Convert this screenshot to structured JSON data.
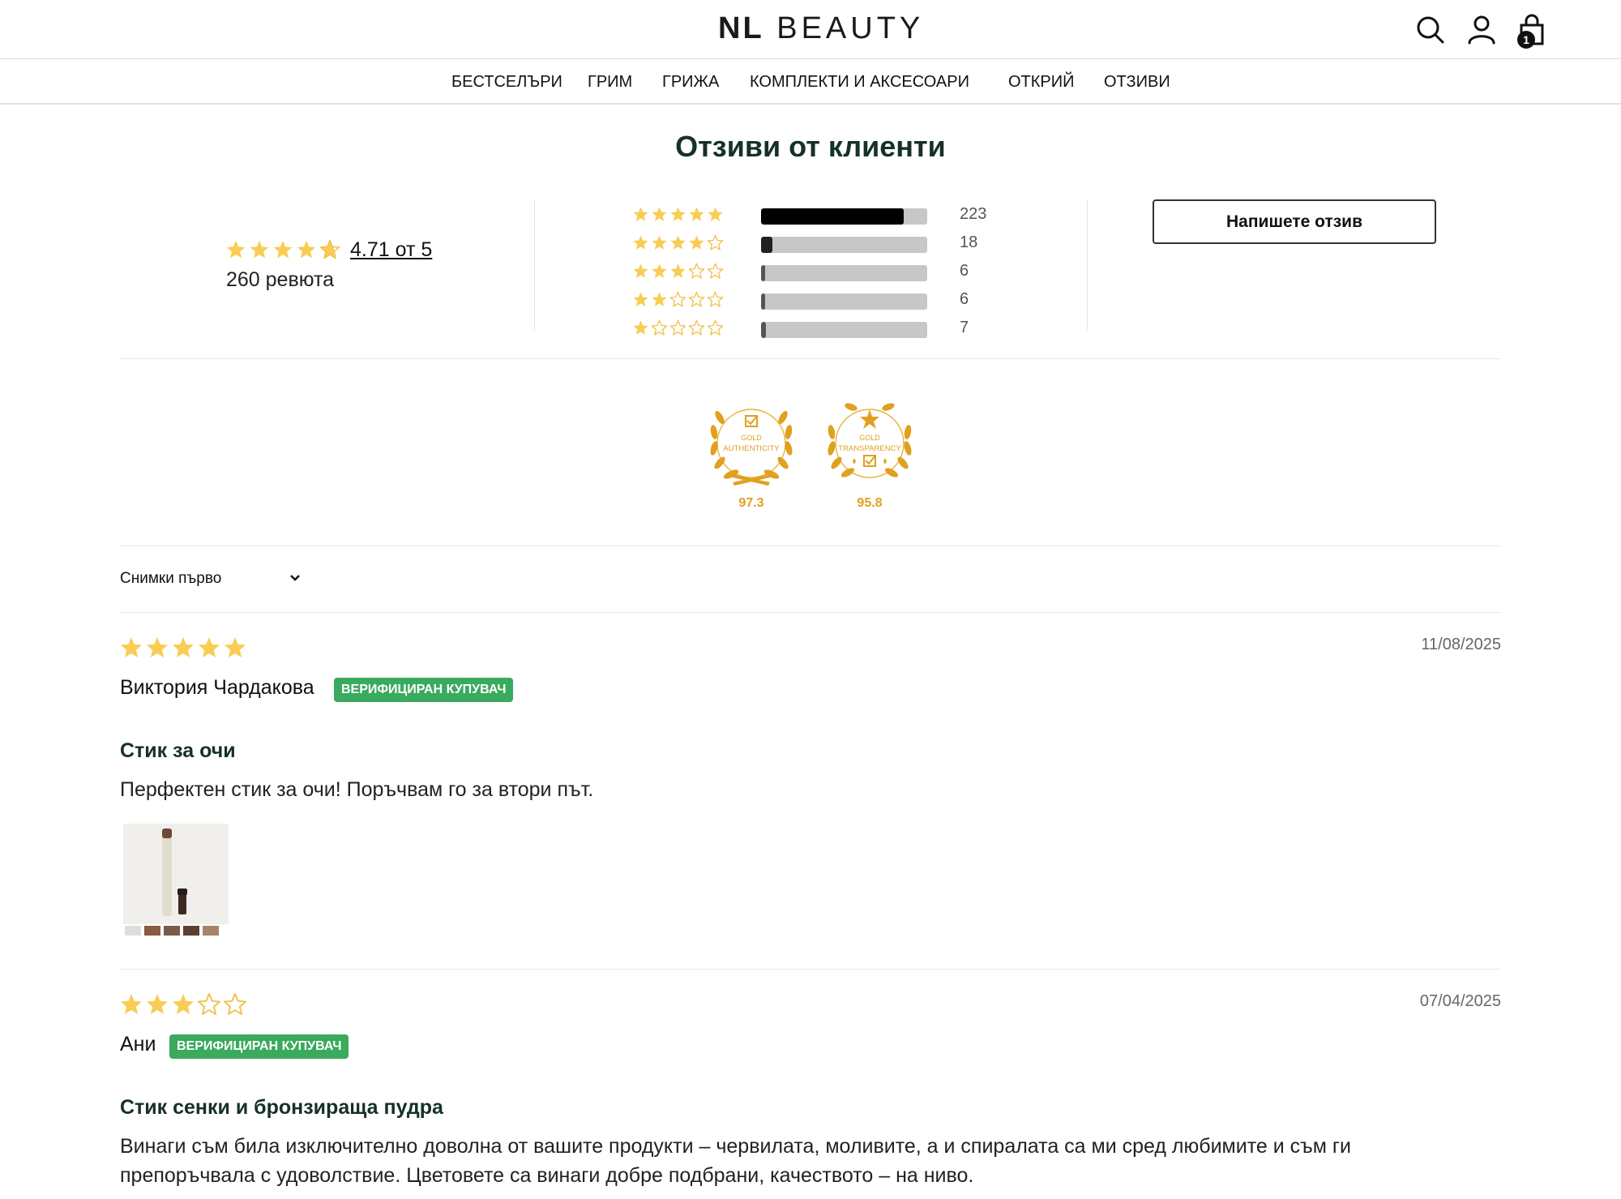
{
  "header": {
    "logo_bold": "NL",
    "logo_light": "BEAUTY",
    "cart_count": "1",
    "icons": [
      "search-icon",
      "account-icon",
      "cart-icon"
    ]
  },
  "nav": {
    "items": [
      "БЕСТСЕЛЪРИ",
      "ГРИМ",
      "ГРИЖА",
      "КОМПЛЕКТИ И АКСЕСОАРИ",
      "ОТКРИЙ",
      "ОТЗИВИ"
    ]
  },
  "summary": {
    "title": "Отзиви от клиенти",
    "average_rating": 4.71,
    "average_text": "4.71 от 5",
    "review_count_text": "260 ревюта",
    "distribution": [
      {
        "stars": 5,
        "count": "223",
        "fraction": 0.858
      },
      {
        "stars": 4,
        "count": "18",
        "fraction": 0.069
      },
      {
        "stars": 3,
        "count": "6",
        "fraction": 0.023
      },
      {
        "stars": 2,
        "count": "6",
        "fraction": 0.023
      },
      {
        "stars": 1,
        "count": "7",
        "fraction": 0.027
      }
    ],
    "write_review_label": "Напишете отзив"
  },
  "badges": [
    {
      "line1": "GOLD",
      "line2": "AUTHENTICITY",
      "score": "97.3"
    },
    {
      "line1": "GOLD",
      "line2": "TRANSPARENCY",
      "score": "95.8"
    }
  ],
  "sort": {
    "selected": "Снимки първо"
  },
  "reviews": [
    {
      "rating": 5,
      "date": "11/08/2025",
      "author": "Виктория Чардакова",
      "verified_label": "ВЕРИФИЦИРАН КУПУВАЧ",
      "title": "Стик за очи",
      "body": "Перфектен стик за очи! Поръчвам го за втори път."
    },
    {
      "rating": 3,
      "date": "07/04/2025",
      "author": "Ани",
      "verified_label": "ВЕРИФИЦИРАН КУПУВАЧ",
      "title": "Стик сенки и бронзираща пудра",
      "body": "Винаги съм била изключително доволна от вашите продукти – червилата, моливите, а и спиралата са ми сред любимите и съм ги препоръчвала с удоволствие. Цветовете са винаги добре подбрани, качеството – на ниво."
    }
  ],
  "colors": {
    "star": "#f9cd55",
    "star_empty_stroke": "#f2c04a",
    "verified": "#3aaa5e",
    "heading": "#16302a",
    "badge_gold": "#e0a020"
  }
}
